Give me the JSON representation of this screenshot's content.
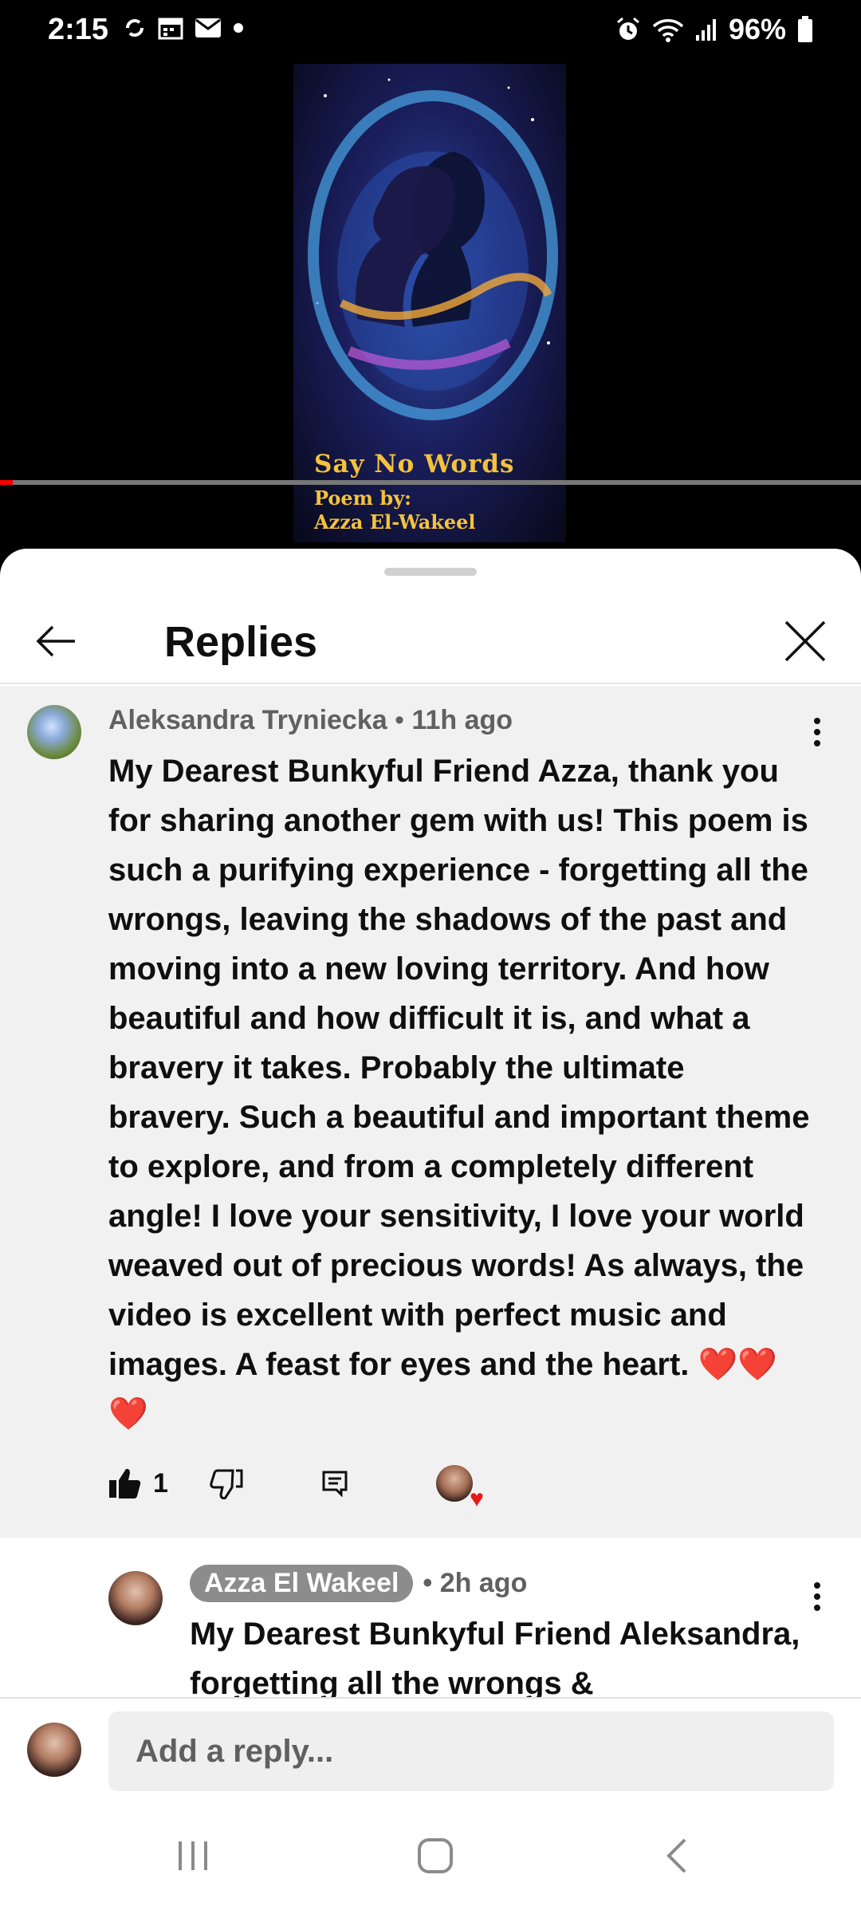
{
  "status_bar": {
    "time": "2:15",
    "battery": "96%",
    "icons_left": [
      "sync-icon",
      "calendar-icon",
      "mail-icon",
      "dot-icon"
    ],
    "icons_right": [
      "alarm-icon",
      "wifi-icon",
      "signal-icon",
      "battery-icon"
    ]
  },
  "video": {
    "poster_title": "Say No Words",
    "poster_line1": "Poem by:",
    "poster_line2": "Azza El-Wakeel",
    "progress_fraction": 0.015,
    "progress_color": "#ff0000"
  },
  "replies_panel": {
    "title": "Replies"
  },
  "main_comment": {
    "author": "Aleksandra Tryniecka",
    "time": "11h ago",
    "text": "My Dearest Bunkyful Friend Azza, thank you for sharing another gem with us! This poem is such a purifying experience - forgetting all the wrongs, leaving the shadows of the past and moving into a new loving territory. And how beautiful and how difficult it is, and what a bravery it takes. Probably the ultimate bravery. Such a beautiful and important theme to explore, and from a completely different angle! I love your sensitivity, I love your world weaved out of precious words! As always, the video is excellent with perfect music and images. A feast for eyes and the heart.",
    "emoji": "❤️❤️❤️",
    "like_count": "1"
  },
  "reply": {
    "author": "Azza El Wakeel",
    "time": "2h ago",
    "text": "My Dearest Bunkyful Friend Aleksandra, forgetting all the wrongs &"
  },
  "composer": {
    "placeholder": "Add a reply..."
  },
  "colors": {
    "accent_heart": "#e21b1b",
    "author_chip": "#8c8c8c",
    "comment_bg": "#f1f1f1"
  }
}
